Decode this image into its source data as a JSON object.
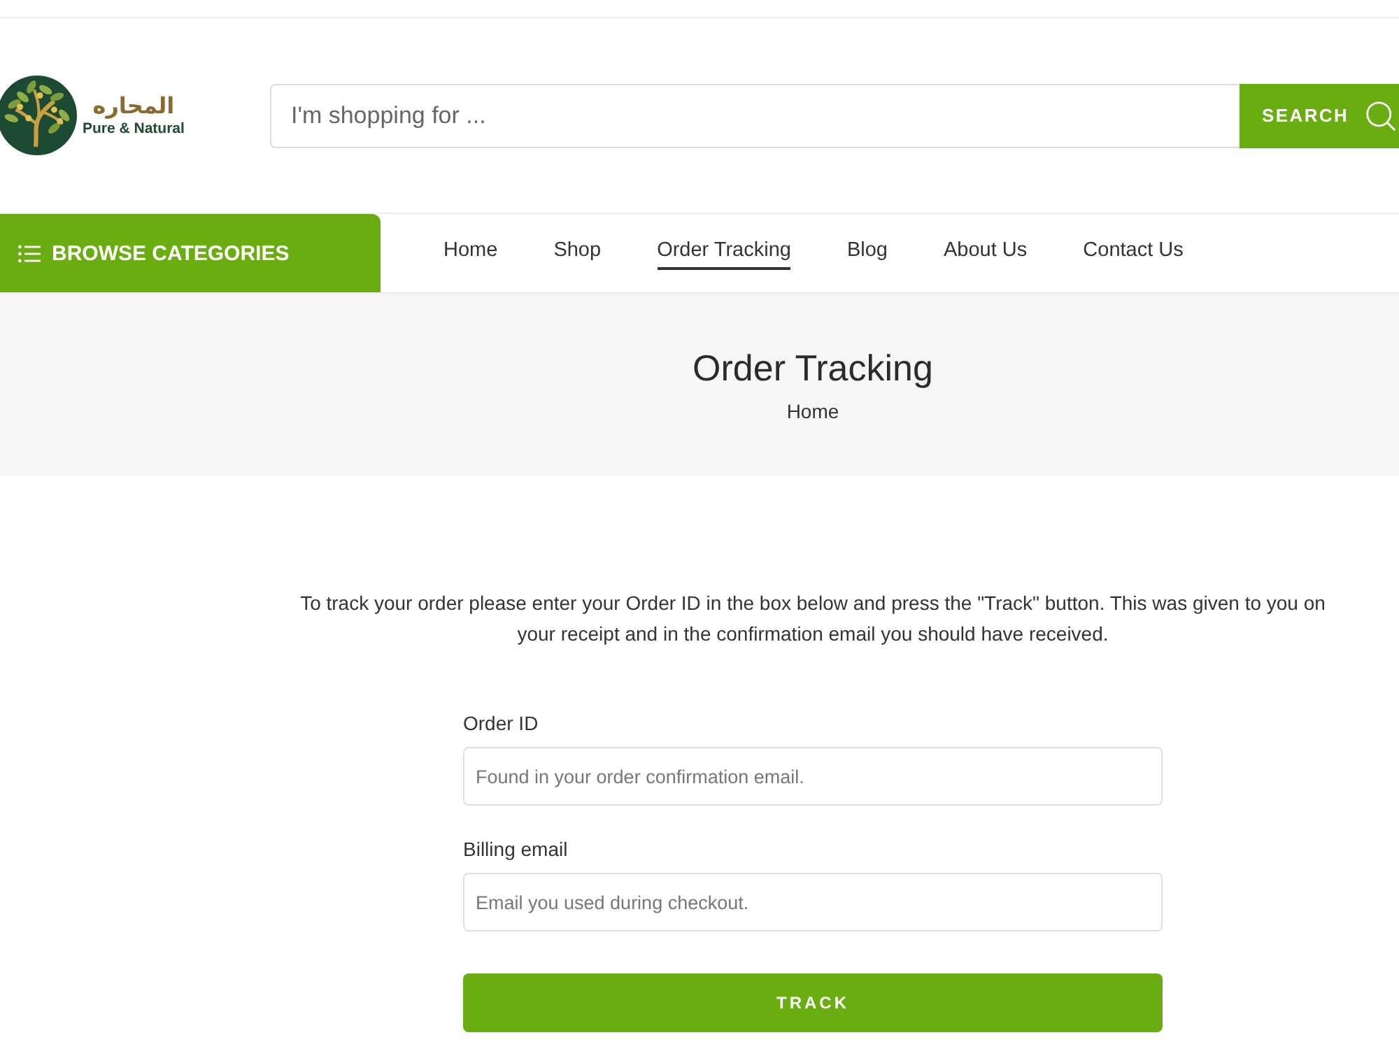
{
  "header": {
    "logo": {
      "name": "المحاره",
      "tagline": "Pure & Natural"
    },
    "search": {
      "placeholder": "I'm shopping for ...",
      "button": "SEARCH"
    }
  },
  "nav": {
    "categories_button": "BROWSE CATEGORIES",
    "items": [
      {
        "label": "Home",
        "selected": false
      },
      {
        "label": "Shop",
        "selected": false
      },
      {
        "label": "Order Tracking",
        "selected": true
      },
      {
        "label": "Blog",
        "selected": false
      },
      {
        "label": "About Us",
        "selected": false
      },
      {
        "label": "Contact Us",
        "selected": false
      }
    ]
  },
  "page_title": {
    "title": "Order Tracking",
    "breadcrumb": "Home"
  },
  "intro": "To track your order please enter your Order ID in the box below and press the \"Track\" button. This was given to you on your receipt and in the confirmation email you should have received.",
  "form": {
    "fields": [
      {
        "label": "Order ID",
        "placeholder": "Found in your order confirmation email."
      },
      {
        "label": "Billing email",
        "placeholder": "Email you used during checkout."
      }
    ],
    "submit": "TRACK"
  }
}
